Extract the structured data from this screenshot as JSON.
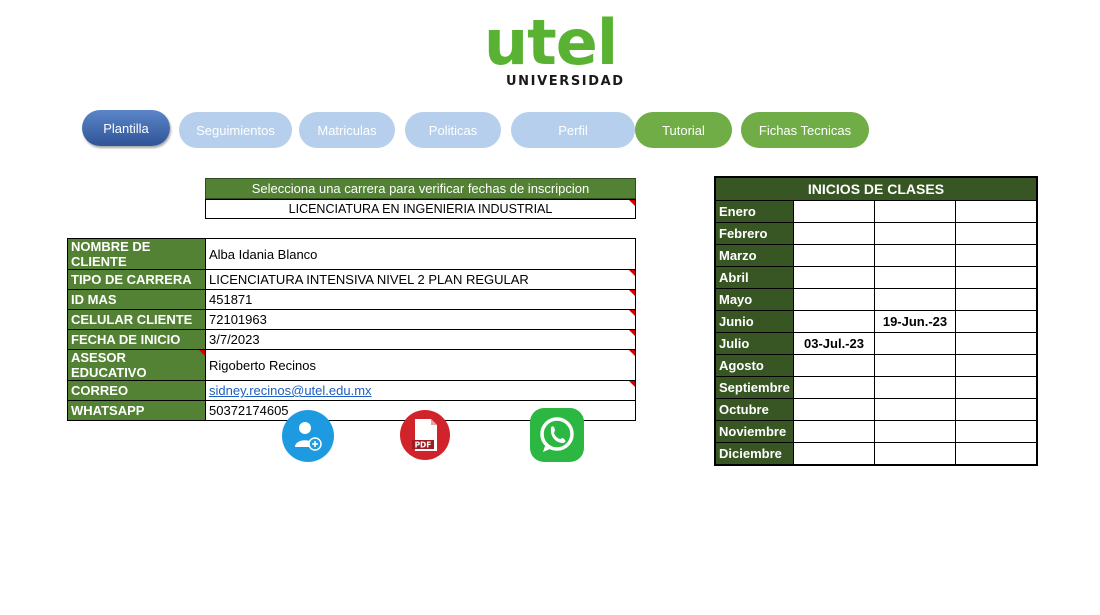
{
  "logo": {
    "text": "utel",
    "subtitle": "UNIVERSIDAD",
    "color": "#5ab233"
  },
  "nav": [
    {
      "label": "Plantilla",
      "style": "blue"
    },
    {
      "label": "Seguimientos",
      "style": "light"
    },
    {
      "label": "Matriculas",
      "style": "light"
    },
    {
      "label": "Politicas",
      "style": "light"
    },
    {
      "label": "Perfil",
      "style": "light"
    },
    {
      "label": "Tutorial",
      "style": "green"
    },
    {
      "label": "Fichas Tecnicas",
      "style": "green"
    }
  ],
  "career": {
    "header": "Selecciona una carrera para verificar fechas de inscripcion",
    "selected": "LICENCIATURA EN INGENIERIA INDUSTRIAL"
  },
  "client": {
    "rows": [
      {
        "label": "NOMBRE DE CLIENTE",
        "value": "Alba Idania Blanco"
      },
      {
        "label": "TIPO DE CARRERA",
        "value": "LICENCIATURA INTENSIVA NIVEL 2 PLAN REGULAR"
      },
      {
        "label": "ID MAS",
        "value": "451871"
      },
      {
        "label": "CELULAR CLIENTE",
        "value": "72101963"
      },
      {
        "label": "FECHA DE INICIO",
        "value": "3/7/2023"
      },
      {
        "label": "ASESOR EDUCATIVO",
        "value": "Rigoberto Recinos"
      },
      {
        "label": "CORREO",
        "value": "sidney.recinos@utel.edu.mx"
      },
      {
        "label": "WHATSAPP",
        "value": "50372174605"
      }
    ]
  },
  "icons": {
    "add_user": "add-user-icon",
    "pdf": {
      "name": "pdf-icon",
      "label": "PDF"
    },
    "whatsapp": "whatsapp-icon"
  },
  "calendar": {
    "title": "INICIOS DE CLASES",
    "months": [
      "Enero",
      "Febrero",
      "Marzo",
      "Abril",
      "Mayo",
      "Junio",
      "Julio",
      "Agosto",
      "Septiembre",
      "Octubre",
      "Noviembre",
      "Diciembre"
    ],
    "cells": [
      [
        "",
        "",
        ""
      ],
      [
        "",
        "",
        ""
      ],
      [
        "",
        "",
        ""
      ],
      [
        "",
        "",
        ""
      ],
      [
        "",
        "",
        ""
      ],
      [
        "",
        "19-Jun.-23",
        ""
      ],
      [
        "03-Jul.-23",
        "",
        ""
      ],
      [
        "",
        "",
        ""
      ],
      [
        "",
        "",
        ""
      ],
      [
        "",
        "",
        ""
      ],
      [
        "",
        "",
        ""
      ],
      [
        "",
        "",
        ""
      ]
    ]
  },
  "colors": {
    "green_header": "#548235",
    "dark_green": "#375623",
    "nav_blue": "#2f5497",
    "nav_light": "#b6cfec",
    "nav_green": "#70ad47",
    "comment_marker": "#d40000"
  }
}
